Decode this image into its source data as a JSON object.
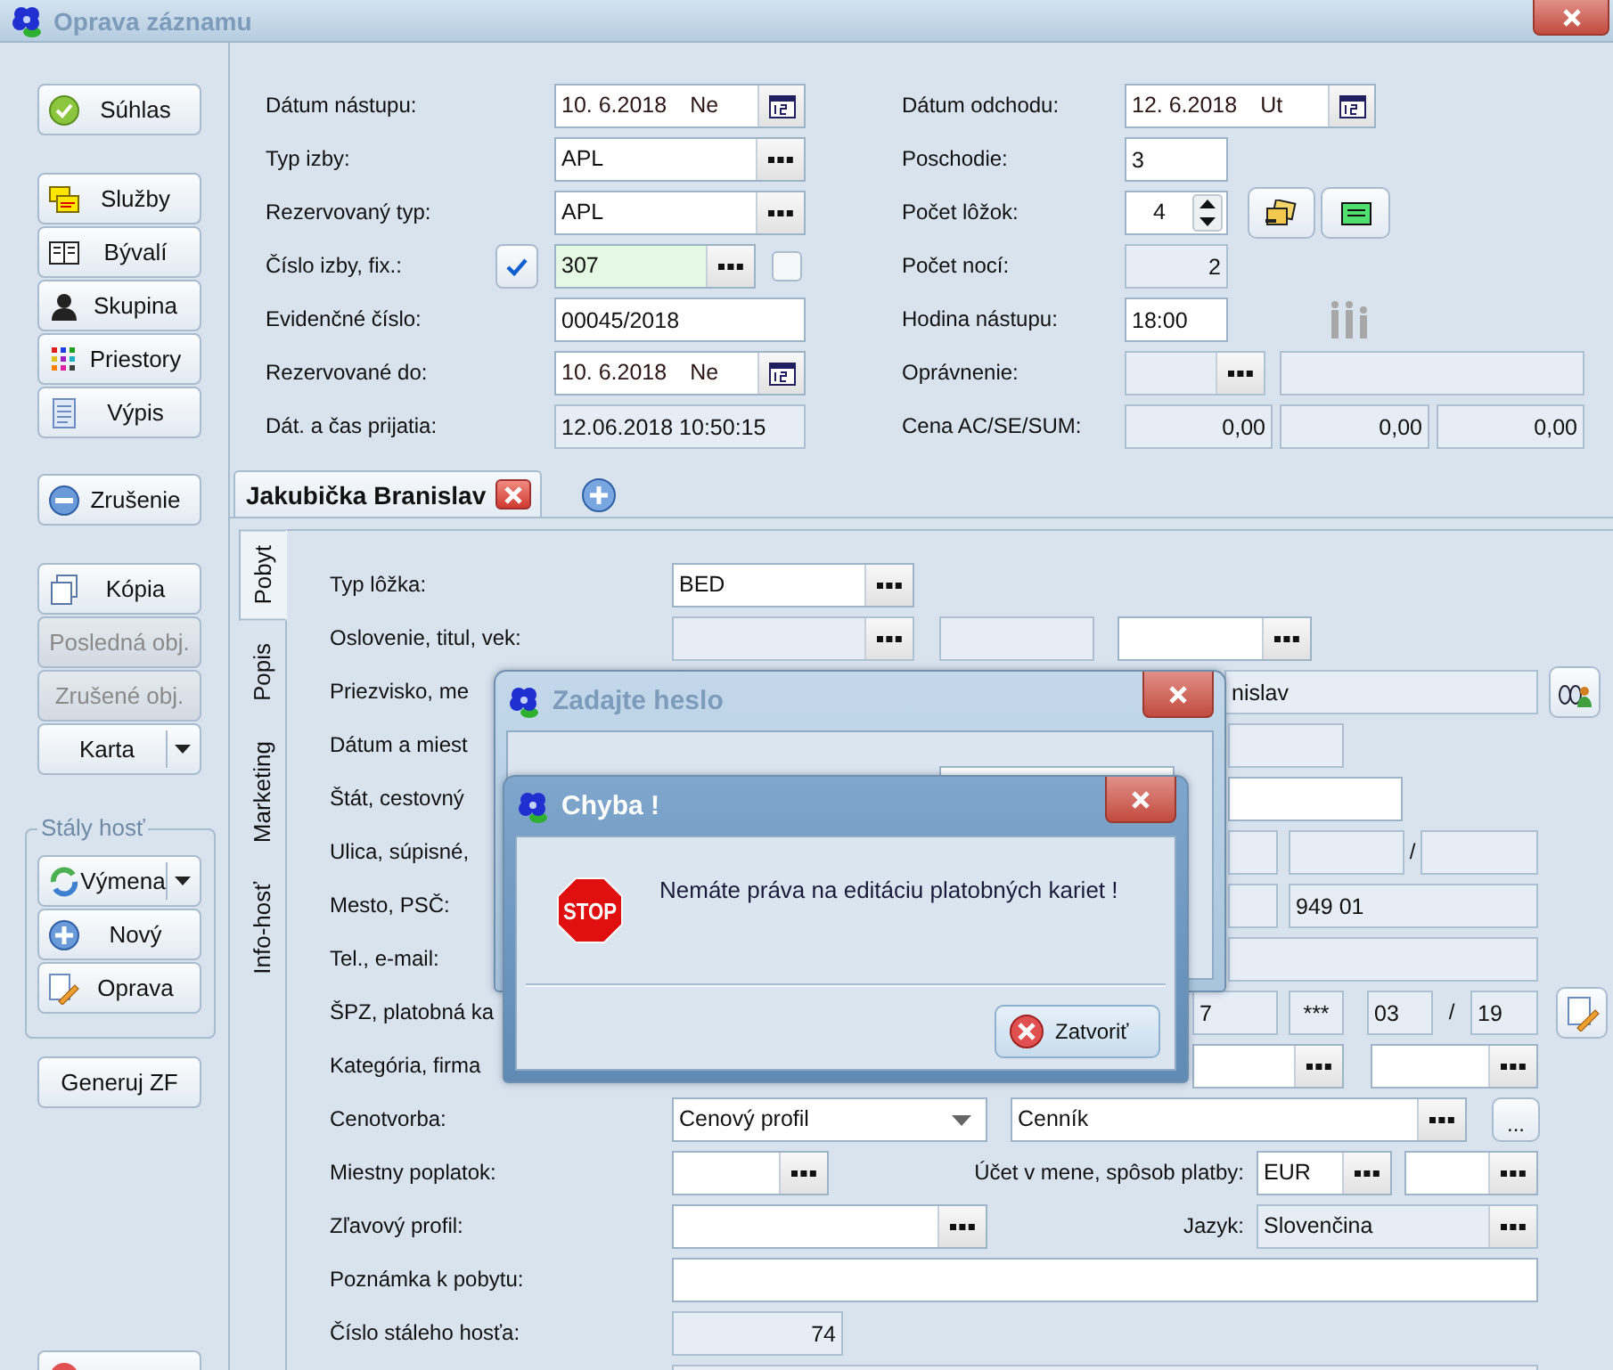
{
  "window": {
    "title": "Oprava záznamu"
  },
  "sidebar": {
    "groups": [
      {
        "buttons": [
          {
            "label": "Súhlas",
            "kind": "plain",
            "disabled": false
          }
        ]
      },
      {
        "buttons": [
          {
            "label": "Služby",
            "kind": "plain",
            "disabled": false
          },
          {
            "label": "Bývalí",
            "kind": "plain",
            "disabled": false
          },
          {
            "label": "Skupina",
            "kind": "plain",
            "disabled": false
          },
          {
            "label": "Priestory",
            "kind": "plain",
            "disabled": false
          },
          {
            "label": "Výpis",
            "kind": "plain",
            "disabled": false
          }
        ]
      },
      {
        "buttons": [
          {
            "label": "Zrušenie",
            "kind": "plain",
            "disabled": false
          }
        ]
      },
      {
        "buttons": [
          {
            "label": "Kópia",
            "kind": "plain",
            "disabled": false
          },
          {
            "label": "Posledná obj.",
            "kind": "plain",
            "disabled": true
          },
          {
            "label": "Zrušené obj.",
            "kind": "plain",
            "disabled": true
          },
          {
            "label": "Karta",
            "kind": "split",
            "disabled": false
          }
        ]
      },
      {
        "title": "Stály hosť",
        "buttons": [
          {
            "label": "Výmena",
            "kind": "split",
            "disabled": false
          },
          {
            "label": "Nový",
            "kind": "plain",
            "disabled": false
          },
          {
            "label": "Oprava",
            "kind": "plain",
            "disabled": false
          }
        ]
      },
      {
        "buttons": [
          {
            "label": "Generuj ZF",
            "kind": "plain",
            "disabled": false
          }
        ]
      },
      {
        "buttons": [
          {
            "kind": "plain",
            "disabled": false
          }
        ]
      }
    ]
  },
  "stay_form": {
    "left": [
      {
        "label": "Dátum nástupu:",
        "items": [
          {
            "kind": "date",
            "value": "10. 6.2018",
            "day": "Ne",
            "disabled": false
          }
        ]
      },
      {
        "label": "Typ izby:",
        "items": [
          {
            "kind": "browse",
            "value": "APL",
            "disabled": false
          }
        ]
      },
      {
        "label": "Rezervovaný typ:",
        "items": [
          {
            "kind": "browse",
            "value": "APL",
            "disabled": false
          }
        ]
      },
      {
        "label": "Číslo izby, fix.:",
        "items": [
          {
            "kind": "toggle",
            "checked": true
          },
          {
            "kind": "browse",
            "value": "307",
            "disabled": false,
            "highlighted": true
          },
          {
            "kind": "checkbox",
            "checked": false
          }
        ]
      },
      {
        "label": "Evidenčné číslo:",
        "items": [
          {
            "kind": "text",
            "value": "00045/2018",
            "disabled": false
          }
        ]
      },
      {
        "label": "Rezervované do:",
        "items": [
          {
            "kind": "date",
            "value": "10. 6.2018",
            "day": "Ne",
            "disabled": false
          }
        ]
      },
      {
        "label": "Dát. a čas prijatia:",
        "items": [
          {
            "kind": "text",
            "value": "12.06.2018 10:50:15",
            "disabled": true
          }
        ]
      }
    ],
    "right": [
      {
        "label": "Dátum odchodu:",
        "items": [
          {
            "kind": "date",
            "value": "12. 6.2018",
            "day": "Ut",
            "disabled": false
          }
        ]
      },
      {
        "label": "Poschodie:",
        "items": [
          {
            "kind": "text",
            "value": "3",
            "disabled": false
          }
        ]
      },
      {
        "label": "Počet lôžok:",
        "items": [
          {
            "kind": "spin",
            "value": "4",
            "disabled": false
          },
          {
            "kind": "cards-tool"
          },
          {
            "kind": "note-tool"
          }
        ]
      },
      {
        "label": "Počet nocí:",
        "items": [
          {
            "kind": "text",
            "value": "2",
            "disabled": true
          }
        ]
      },
      {
        "label": "Hodina nástupu:",
        "items": [
          {
            "kind": "text",
            "value": "18:00",
            "disabled": false
          },
          {
            "kind": "people"
          }
        ]
      },
      {
        "label": "Oprávnenie:",
        "items": [
          {
            "kind": "browse",
            "disabled": true
          },
          {
            "kind": "text",
            "disabled": true
          }
        ]
      },
      {
        "label": "Cena AC/SE/SUM:",
        "items": [
          {
            "kind": "text",
            "value": "0,00",
            "disabled": true
          },
          {
            "kind": "text",
            "value": "0,00",
            "disabled": true
          },
          {
            "kind": "text",
            "value": "0,00",
            "disabled": true
          }
        ]
      }
    ]
  },
  "guest_tabs": [
    {
      "label": "Jakubička Branislav",
      "selected": true
    }
  ],
  "side_tabs": [
    {
      "label": "Pobyt",
      "selected": true
    },
    {
      "label": "Popis",
      "selected": false
    },
    {
      "label": "Marketing",
      "selected": false
    },
    {
      "label": "Info-hosť",
      "selected": false
    }
  ],
  "guest_form": {
    "rows": [
      {
        "label": "Typ lôžka:",
        "items": [
          {
            "kind": "browse",
            "value": "BED",
            "disabled": false
          }
        ]
      },
      {
        "label": "Oslovenie, titul, vek:",
        "items": [
          {
            "kind": "browse",
            "disabled": true
          },
          {
            "kind": "text",
            "disabled": true
          },
          {
            "kind": "browse",
            "disabled": false
          }
        ]
      },
      {
        "label": "Priezvisko, me",
        "items": [
          {
            "kind": "text",
            "value": "nislav",
            "disabled": true
          },
          {
            "kind": "lookup"
          }
        ]
      },
      {
        "label": "Dátum a miest",
        "items": [
          {
            "kind": "text",
            "disabled": true
          }
        ]
      },
      {
        "label": "Štát, cestovný",
        "items": [
          {
            "kind": "text",
            "disabled": false
          }
        ]
      },
      {
        "label": "Ulica, súpisné,",
        "items": [
          {
            "kind": "text",
            "disabled": true
          },
          {
            "kind": "text",
            "disabled": true
          },
          {
            "kind": "sep",
            "text": "/"
          },
          {
            "kind": "text",
            "disabled": true
          }
        ]
      },
      {
        "label": "Mesto, PSČ:",
        "items": [
          {
            "kind": "text",
            "disabled": true
          },
          {
            "kind": "text",
            "value": "949 01",
            "disabled": true
          }
        ]
      },
      {
        "label": "Tel., e-mail:",
        "items": [
          {
            "kind": "text",
            "disabled": true
          }
        ]
      },
      {
        "label": "ŠPZ, platobná ka",
        "items": [
          {
            "kind": "text",
            "value": "7",
            "disabled": true
          },
          {
            "kind": "text",
            "value": "***",
            "disabled": true
          },
          {
            "kind": "text",
            "value": "03",
            "disabled": true
          },
          {
            "kind": "sep",
            "text": "/"
          },
          {
            "kind": "text",
            "value": "19",
            "disabled": true
          },
          {
            "kind": "edit"
          }
        ]
      },
      {
        "label": "Kategória, firma",
        "items": [
          {
            "kind": "browse",
            "disabled": false
          },
          {
            "kind": "browse",
            "disabled": false
          }
        ]
      },
      {
        "label": "Cenotvorba:",
        "items": [
          {
            "kind": "select",
            "value": "Cenový profil"
          },
          {
            "kind": "browse",
            "value": "Cenník",
            "disabled": false
          },
          {
            "kind": "button",
            "label": "..."
          }
        ]
      },
      {
        "label": "Miestny poplatok:",
        "items": [
          {
            "kind": "browse",
            "disabled": false
          },
          {
            "kind": "label",
            "text": "Účet v mene, spôsob platby:"
          },
          {
            "kind": "browse",
            "value": "EUR",
            "disabled": false
          },
          {
            "kind": "browse",
            "disabled": false
          }
        ]
      },
      {
        "label": "Zľavový profil:",
        "items": [
          {
            "kind": "browse",
            "disabled": false
          },
          {
            "kind": "label",
            "text": "Jazyk:"
          },
          {
            "kind": "browse",
            "value": "Slovenčina",
            "disabled": true
          }
        ]
      },
      {
        "label": "Poznámka k pobytu:",
        "items": [
          {
            "kind": "text",
            "disabled": false
          }
        ]
      },
      {
        "label": "Číslo stáleho hosťa:",
        "items": [
          {
            "kind": "text",
            "value": "74",
            "disabled": true
          }
        ]
      },
      {
        "items": [
          {
            "kind": "text",
            "disabled": true
          }
        ]
      }
    ]
  },
  "dialogs": [
    {
      "kind": "password",
      "title": "Zadajte heslo",
      "active": false
    },
    {
      "kind": "message",
      "title": "Chyba !",
      "active": true,
      "icon_text": "STOP",
      "message": "Nemáte práva na editáciu platobných kariet !",
      "buttons": [
        {
          "label": "Zatvoriť"
        }
      ]
    }
  ]
}
